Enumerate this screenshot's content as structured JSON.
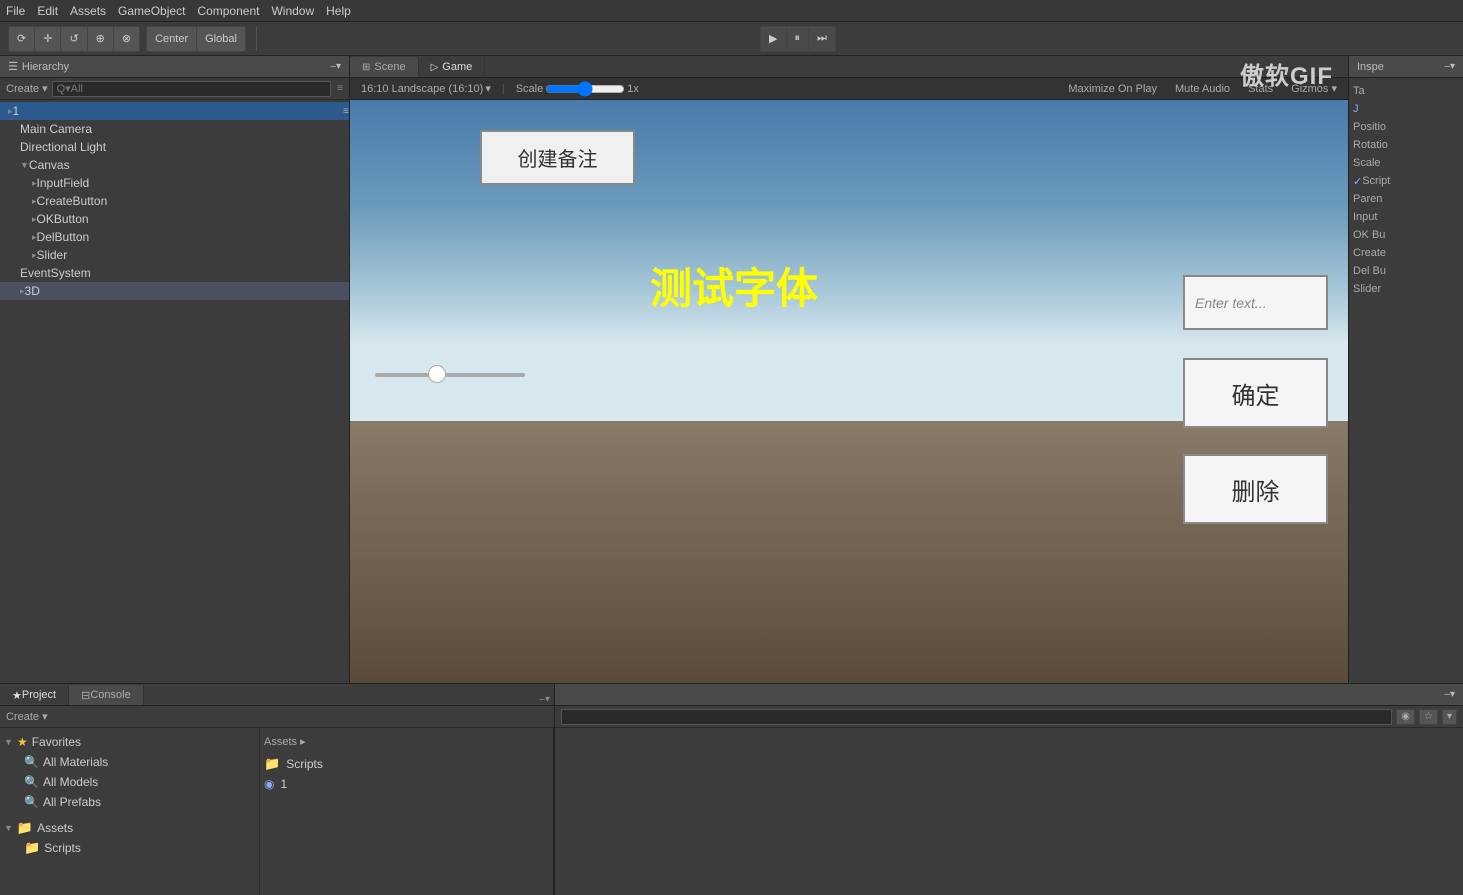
{
  "app": {
    "title": "Unity Editor"
  },
  "watermark": "傲软GIF",
  "menu": {
    "items": [
      "File",
      "Edit",
      "Assets",
      "GameObject",
      "Component",
      "Window",
      "Help"
    ]
  },
  "toolbar": {
    "transform_tools": [
      "⟳",
      "+",
      "↺",
      "⊕",
      "⊗"
    ],
    "center_label": "Center",
    "global_label": "Global",
    "play_buttons": [
      "▶",
      "⏸",
      "⏭"
    ],
    "scene_label": "Scene",
    "game_label": "Game"
  },
  "hierarchy": {
    "title": "Hierarchy",
    "create_label": "Create ▾",
    "search_placeholder": "Q▾All",
    "items": [
      {
        "label": "▸ 1",
        "indent": 0,
        "id": "root-1"
      },
      {
        "label": "Main Camera",
        "indent": 1,
        "id": "main-camera"
      },
      {
        "label": "Directional Light",
        "indent": 1,
        "id": "dir-light"
      },
      {
        "label": "▼ Canvas",
        "indent": 1,
        "id": "canvas"
      },
      {
        "label": "▸ InputField",
        "indent": 2,
        "id": "input-field"
      },
      {
        "label": "▸ CreateButton",
        "indent": 2,
        "id": "create-button"
      },
      {
        "label": "▸ OKButton",
        "indent": 2,
        "id": "ok-button"
      },
      {
        "label": "▸ DelButton",
        "indent": 2,
        "id": "del-button"
      },
      {
        "label": "▸ Slider",
        "indent": 2,
        "id": "slider"
      },
      {
        "label": "EventSystem",
        "indent": 1,
        "id": "event-system"
      },
      {
        "label": "▸ 3D",
        "indent": 1,
        "id": "3d"
      }
    ]
  },
  "game_view": {
    "tab_scene": "Scene",
    "tab_game": "Game",
    "resolution_label": "16:10 Landscape (16:10)",
    "scale_label": "Scale",
    "scale_value": "1x",
    "maximize_on_play": "Maximize On Play",
    "mute_audio": "Mute Audio",
    "stats_label": "Stats",
    "gizmos_label": "Gizmos ▾",
    "create_btn_text": "创建备注",
    "main_text": "测试字体",
    "input_placeholder": "Enter text...",
    "ok_btn_text": "确定",
    "del_btn_text": "删除"
  },
  "inspector": {
    "title": "Inspe",
    "tab_label": "Ta",
    "rows": [
      "Positio",
      "Rotatio",
      "Scale",
      "",
      "Script",
      "Paren",
      "Input",
      "OK Bu",
      "Create",
      "Del Bu",
      "Slider"
    ]
  },
  "project": {
    "tab_project": "Project",
    "tab_console": "Console",
    "create_label": "Create ▾",
    "favorites": {
      "label": "Favorites",
      "items": [
        "All Materials",
        "All Models",
        "All Prefabs"
      ]
    },
    "assets": {
      "label": "Assets",
      "items": [
        "Scripts"
      ]
    }
  },
  "assets_panel": {
    "breadcrumb": "Assets ▸",
    "items": [
      {
        "type": "folder",
        "name": "Scripts"
      },
      {
        "type": "file",
        "name": "1"
      }
    ]
  },
  "insp_bottom": {
    "search_placeholder": ""
  },
  "colors": {
    "accent_blue": "#2d5a8e",
    "sky_top": "#4a7aaa",
    "ui_bg": "#3c3c3c",
    "panel_bg": "#4a4a4a",
    "game_text_color": "#ffff00",
    "game_btn_bg": "#f0f0f0"
  }
}
